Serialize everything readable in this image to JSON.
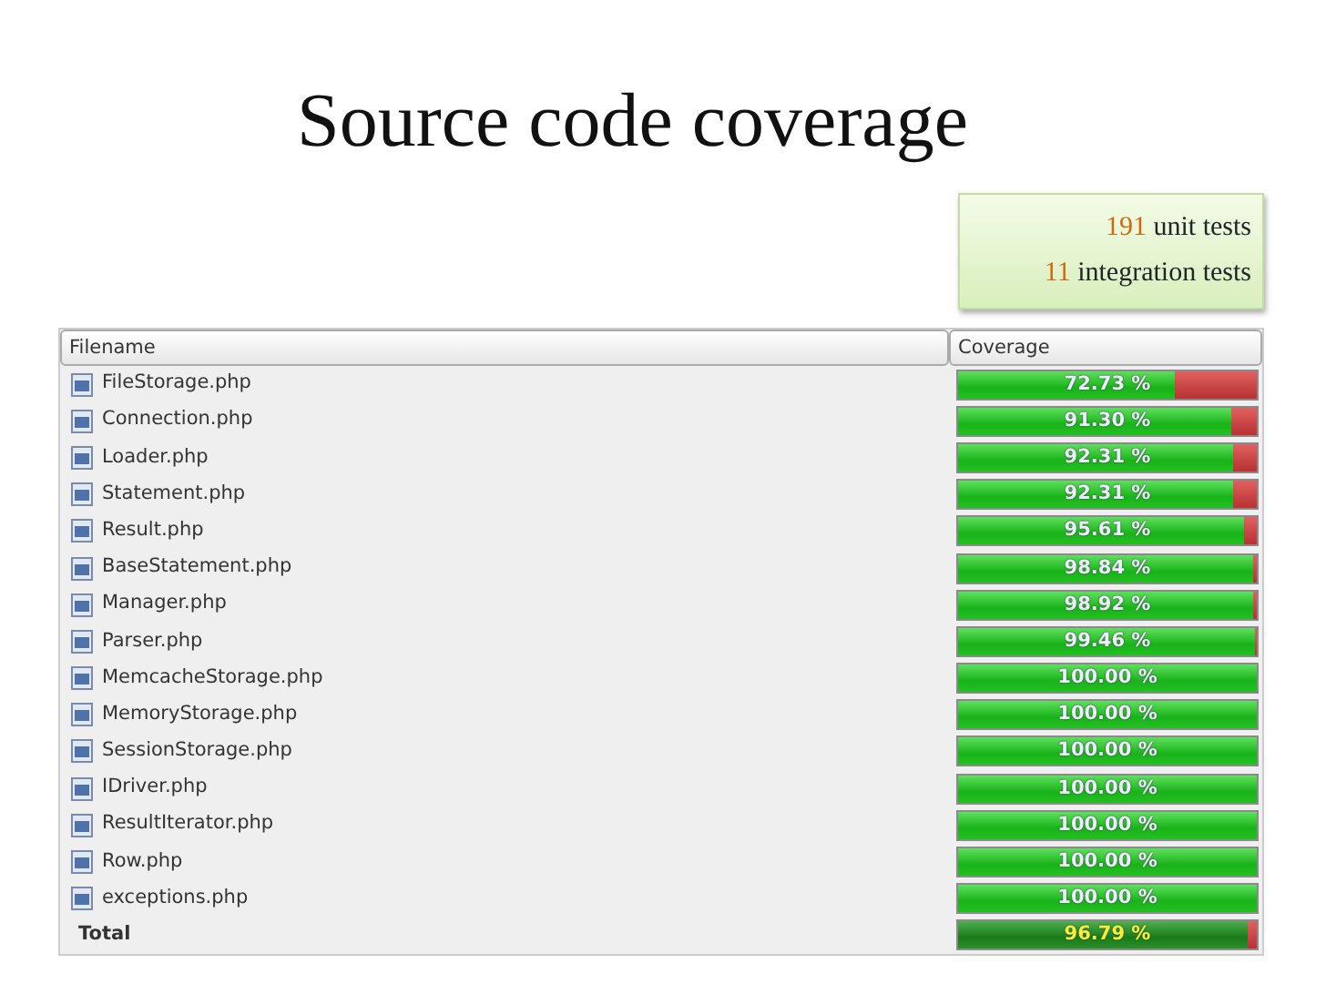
{
  "title": "Source code coverage",
  "test_counts": [
    {
      "count": "191",
      "label": "unit tests"
    },
    {
      "count": "11",
      "label": "integration tests"
    }
  ],
  "table": {
    "columns": [
      "Filename",
      "Coverage"
    ],
    "rows": [
      {
        "kind": "file",
        "filename": "FileStorage.php",
        "coverage": "72.73 %",
        "level": 0.7273
      },
      {
        "kind": "file",
        "filename": "Connection.php",
        "coverage": "91.30 %",
        "level": 0.913
      },
      {
        "kind": "file",
        "filename": "Loader.php",
        "coverage": "92.31 %",
        "level": 0.9231
      },
      {
        "kind": "file",
        "filename": "Statement.php",
        "coverage": "92.31 %",
        "level": 0.9231
      },
      {
        "kind": "file",
        "filename": "Result.php",
        "coverage": "95.61 %",
        "level": 0.9561
      },
      {
        "kind": "file",
        "filename": "BaseStatement.php",
        "coverage": "98.84 %",
        "level": 0.9884
      },
      {
        "kind": "file",
        "filename": "Manager.php",
        "coverage": "98.92 %",
        "level": 0.9892
      },
      {
        "kind": "file",
        "filename": "Parser.php",
        "coverage": "99.46 %",
        "level": 0.9946
      },
      {
        "kind": "file",
        "filename": "MemcacheStorage.php",
        "coverage": "100.00 %",
        "level": 1
      },
      {
        "kind": "file",
        "filename": "MemoryStorage.php",
        "coverage": "100.00 %",
        "level": 1
      },
      {
        "kind": "file",
        "filename": "SessionStorage.php",
        "coverage": "100.00 %",
        "level": 1
      },
      {
        "kind": "file",
        "filename": "IDriver.php",
        "coverage": "100.00 %",
        "level": 1
      },
      {
        "kind": "file",
        "filename": "ResultIterator.php",
        "coverage": "100.00 %",
        "level": 1
      },
      {
        "kind": "file",
        "filename": "Row.php",
        "coverage": "100.00 %",
        "level": 1
      },
      {
        "kind": "file",
        "filename": "exceptions.php",
        "coverage": "100.00 %",
        "level": 1
      },
      {
        "kind": "total",
        "filename": "Total",
        "coverage": "96.79 %",
        "level": 0.9679
      }
    ]
  }
}
